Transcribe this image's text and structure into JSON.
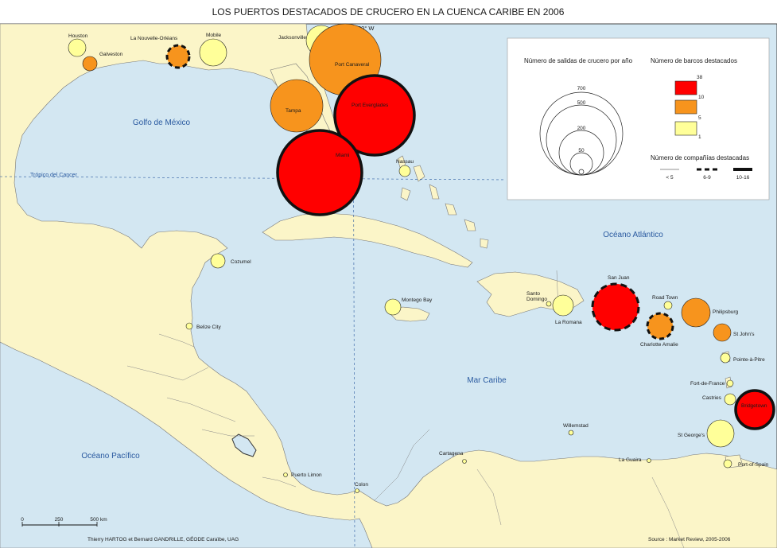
{
  "title": "LOS PUERTOS DESTACADOS DE CRUCERO EN LA CUENCA CARIBE EN 2006",
  "meridian_label": "80° W",
  "tropic_label": "Trópico del Cancer",
  "seas": {
    "gulf": "Golfo de México",
    "atlantic": "Océano Atlántico",
    "caribbean": "Mar Caribe",
    "pacific": "Océano Pacífico"
  },
  "legend": {
    "departures_title": "Número de salidas de crucero por año",
    "departures_values": [
      "700",
      "500",
      "200",
      "50"
    ],
    "ships_title": "Número de barcos destacados",
    "ships_values": [
      "38",
      "10",
      "5",
      "1"
    ],
    "companies_title": "Número de compañías destacadas",
    "companies_values": [
      "< 5",
      "6-9",
      "10-16"
    ],
    "colors": {
      "high": "#ff0000",
      "mid": "#f7941d",
      "low": "#ffff99"
    }
  },
  "scale": {
    "labels": [
      "0",
      "250",
      "500 km"
    ]
  },
  "credits": {
    "authors": "Thierry HARTOG et Bernard GANDRILLE, GÉODE Caraïbe, UAG",
    "source": "Source : Market Review, 2005-2006"
  },
  "ports": [
    {
      "name": "Houston",
      "ships": "low",
      "companies": "low"
    },
    {
      "name": "Galveston",
      "ships": "mid",
      "companies": "low"
    },
    {
      "name": "La Nouvelle-Orléans",
      "ships": "mid",
      "companies": "med"
    },
    {
      "name": "Mobile",
      "ships": "low",
      "companies": "low"
    },
    {
      "name": "Jacksonville",
      "ships": "low",
      "companies": "low"
    },
    {
      "name": "Port Canaveral",
      "ships": "mid",
      "companies": "low"
    },
    {
      "name": "Port Everglades",
      "ships": "high",
      "companies": "high"
    },
    {
      "name": "Tampa",
      "ships": "mid",
      "companies": "low"
    },
    {
      "name": "Miami",
      "ships": "high",
      "companies": "high"
    },
    {
      "name": "Nassau",
      "ships": "low",
      "companies": "low"
    },
    {
      "name": "Cozumel",
      "ships": "low",
      "companies": "low"
    },
    {
      "name": "Belize City",
      "ships": "low",
      "companies": "low"
    },
    {
      "name": "Montego Bay",
      "ships": "low",
      "companies": "low"
    },
    {
      "name": "Santo\nDomingo",
      "ships": "low",
      "companies": "low"
    },
    {
      "name": "La Romana",
      "ships": "low",
      "companies": "low"
    },
    {
      "name": "San Juan",
      "ships": "high",
      "companies": "med"
    },
    {
      "name": "Charlotte Amalie",
      "ships": "mid",
      "companies": "med"
    },
    {
      "name": "Road Town",
      "ships": "low",
      "companies": "low"
    },
    {
      "name": "Philipsburg",
      "ships": "mid",
      "companies": "low"
    },
    {
      "name": "St John's",
      "ships": "mid",
      "companies": "low"
    },
    {
      "name": "Pointe-à-Pitre",
      "ships": "low",
      "companies": "low"
    },
    {
      "name": "Fort-de-France",
      "ships": "low",
      "companies": "low"
    },
    {
      "name": "Castries",
      "ships": "low",
      "companies": "low"
    },
    {
      "name": "Bridgetown",
      "ships": "high",
      "companies": "high"
    },
    {
      "name": "St George's",
      "ships": "low",
      "companies": "low"
    },
    {
      "name": "Port-of-Spain",
      "ships": "low",
      "companies": "low"
    },
    {
      "name": "La Guaira",
      "ships": "low",
      "companies": "low"
    },
    {
      "name": "Willemstad",
      "ships": "low",
      "companies": "low"
    },
    {
      "name": "Cartagena",
      "ships": "low",
      "companies": "low"
    },
    {
      "name": "Colon",
      "ships": "low",
      "companies": "low"
    },
    {
      "name": "Puerto Limon",
      "ships": "low",
      "companies": "low"
    }
  ]
}
